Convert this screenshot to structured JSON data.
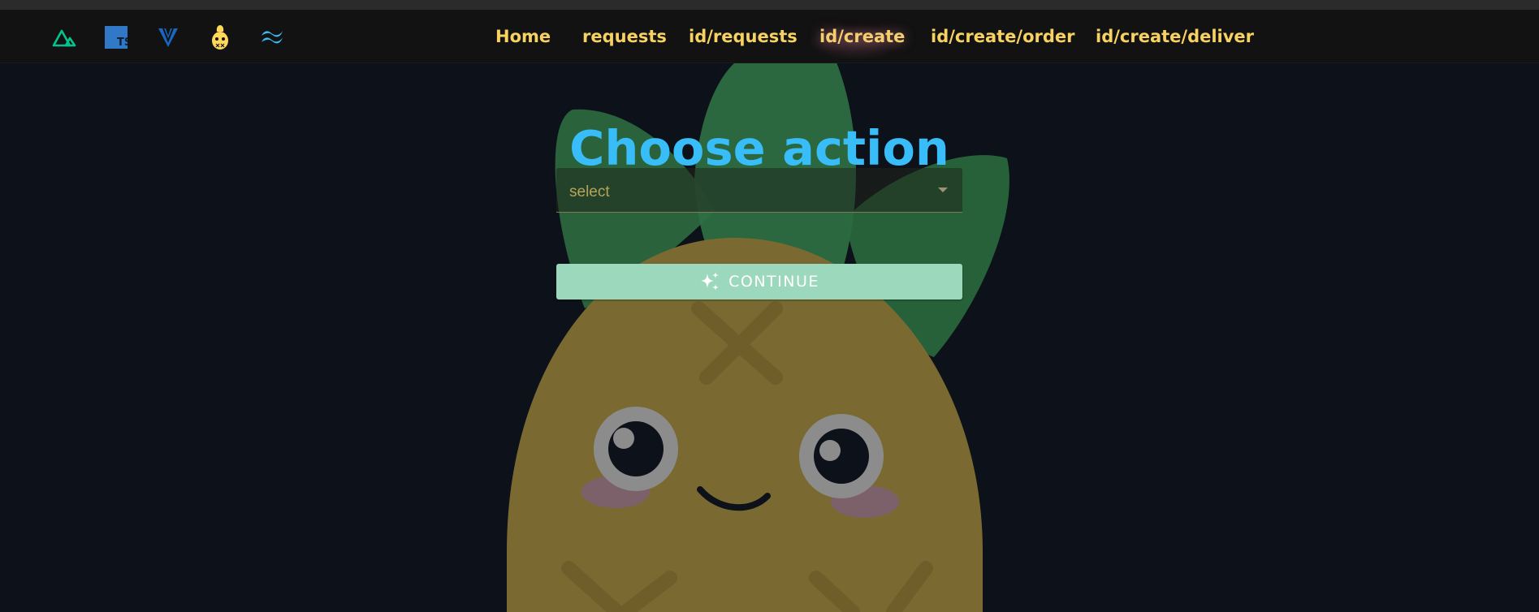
{
  "nav": {
    "tech_icons": [
      {
        "name": "nuxt-icon",
        "color": "#00c58e"
      },
      {
        "name": "typescript-icon",
        "color": "#3178c6",
        "text": "TS"
      },
      {
        "name": "vuetify-icon",
        "color": "#1867c0"
      },
      {
        "name": "pinia-icon",
        "color": "#ffd859"
      },
      {
        "name": "tailwind-icon",
        "color": "#38bdf8"
      }
    ],
    "links": [
      {
        "label": "Home"
      },
      {
        "label": "requests"
      },
      {
        "label": "id/requests"
      },
      {
        "label": "id/create",
        "active": true
      },
      {
        "label": "id/create/order"
      },
      {
        "label": "id/create/deliver"
      }
    ]
  },
  "main": {
    "title": "Choose action",
    "select": {
      "placeholder": "select"
    },
    "continue_button": {
      "label": "CONTINUE",
      "icon": "sparkles-icon"
    }
  },
  "colors": {
    "background": "#0d1119",
    "navbar": "#121212",
    "nav_link": "#f7d260",
    "title": "#38bdf8",
    "button": "#9cd8bb",
    "placeholder": "#b7a45a"
  }
}
